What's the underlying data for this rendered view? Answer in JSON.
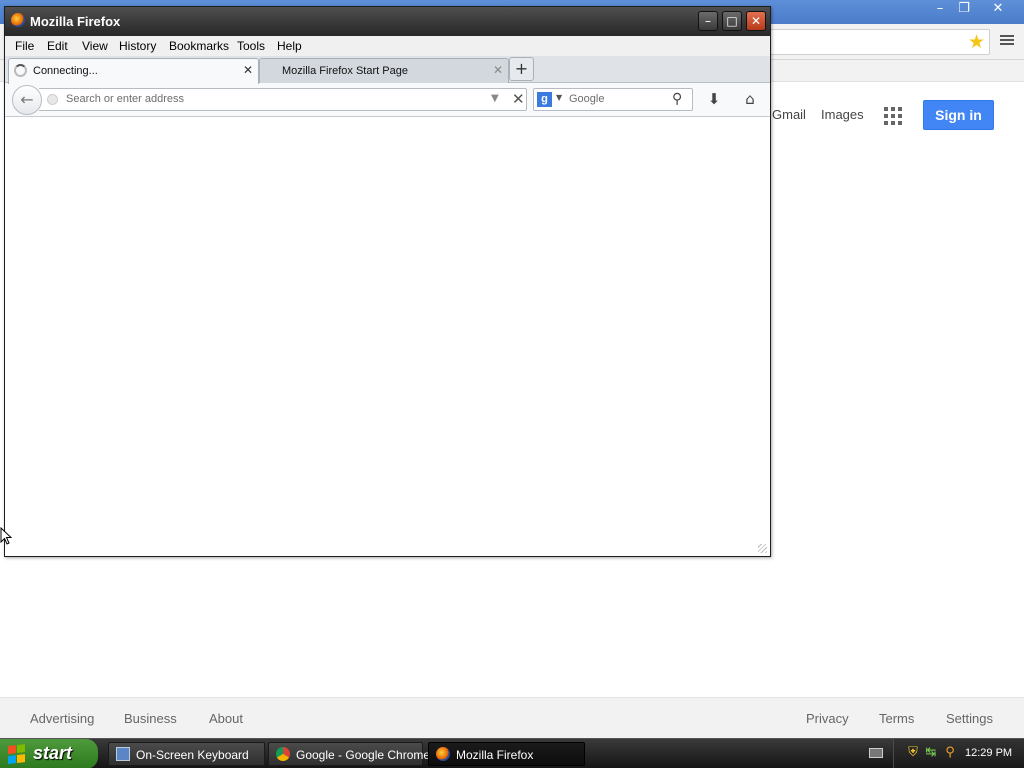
{
  "chrome_bg": {
    "links": {
      "gmail": "Gmail",
      "images": "Images"
    },
    "signin_label": "Sign in",
    "footer": {
      "advertising": "Advertising",
      "business": "Business",
      "about": "About",
      "privacy": "Privacy",
      "terms": "Terms",
      "settings": "Settings"
    }
  },
  "firefox": {
    "title": "Mozilla Firefox",
    "menu": [
      "File",
      "Edit",
      "View",
      "History",
      "Bookmarks",
      "Tools",
      "Help"
    ],
    "tabs": [
      {
        "label": "Connecting...",
        "state": "loading",
        "active": true
      },
      {
        "label": "Mozilla Firefox Start Page",
        "active": false
      }
    ],
    "url_placeholder": "Search or enter address",
    "search_engine": "Google",
    "search_placeholder": "Google"
  },
  "taskbar": {
    "start_label": "start",
    "tasks": [
      {
        "label": "On-Screen Keyboard",
        "icon": "keyboard-icon",
        "active": false
      },
      {
        "label": "Google - Google Chrome",
        "icon": "chrome-icon",
        "active": false
      },
      {
        "label": "Mozilla Firefox",
        "icon": "firefox-icon",
        "active": true
      }
    ],
    "clock": "12:29 PM"
  },
  "colors": {
    "signin_blue": "#4285f4",
    "xp_start_green": "#3c8a2e",
    "firefox_titlebar": "#2e2e2e"
  }
}
